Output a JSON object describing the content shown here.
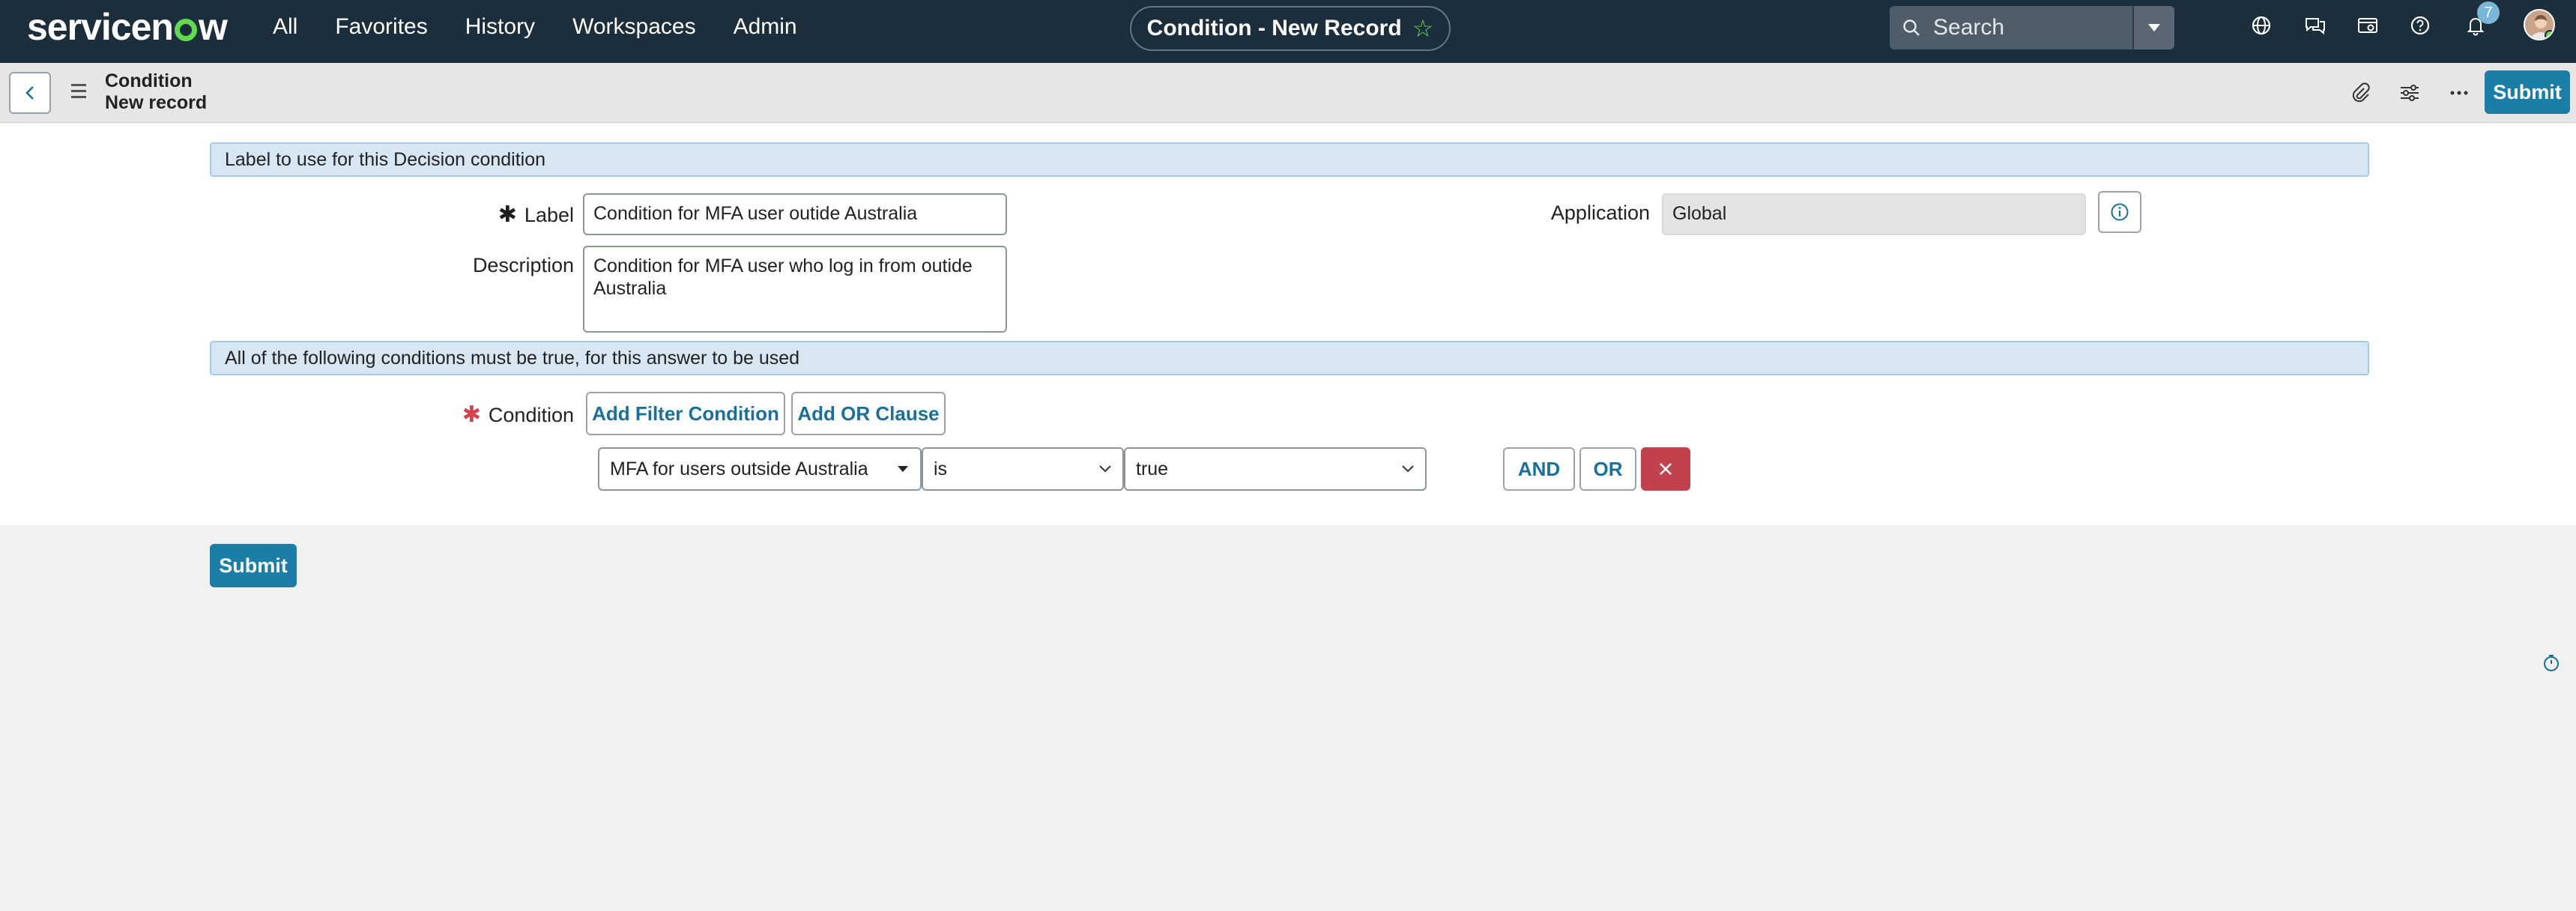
{
  "nav": {
    "logo": "servicenow",
    "links": [
      "All",
      "Favorites",
      "History",
      "Workspaces",
      "Admin"
    ],
    "record_title": "Condition - New Record",
    "search_placeholder": "Search",
    "notification_count": "7"
  },
  "header": {
    "breadcrumb_line1": "Condition",
    "breadcrumb_line2": "New record",
    "submit_label": "Submit"
  },
  "form": {
    "section1": "Label to use for this Decision condition",
    "label_label": "Label",
    "label_value": "Condition for MFA user outide Australia",
    "description_label": "Description",
    "description_value": "Condition for MFA user who log in from outide Australia",
    "application_label": "Application",
    "application_value": "Global",
    "section2": "All of the following conditions must be true, for this answer to be used",
    "condition_label": "Condition",
    "add_filter_label": "Add Filter Condition",
    "add_or_label": "Add OR Clause",
    "condition_field": "MFA for users outside Australia",
    "condition_operator": "is",
    "condition_value": "true",
    "and_label": "AND",
    "or_label": "OR",
    "submit_label": "Submit"
  },
  "colors": {
    "nav_bg": "#1c2d3b",
    "accent": "#1a7ea7",
    "brand_green": "#62d84e",
    "delete": "#c1424d",
    "section_bg": "#d6e6f3"
  }
}
